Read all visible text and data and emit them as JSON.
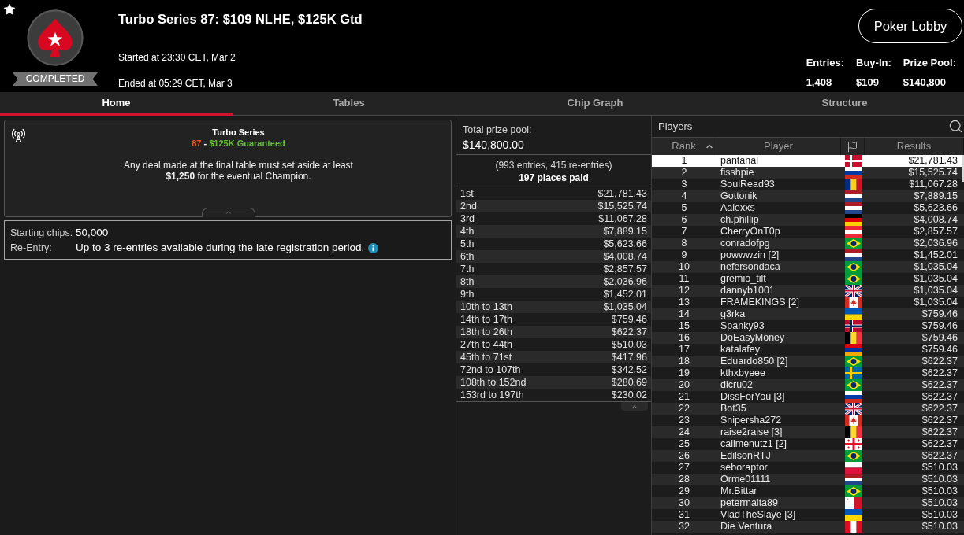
{
  "header": {
    "status_badge": "COMPLETED",
    "title": "Turbo Series 87: $109 NLHE, $125K Gtd",
    "started": "Started at 23:30 CET, Mar 2",
    "ended": "Ended at 05:29 CET, Mar 3",
    "lobby_button": "Poker Lobby",
    "stats": [
      {
        "label": "Entries:",
        "value": "1,408"
      },
      {
        "label": "Buy-In:",
        "value": "$109"
      },
      {
        "label": "Prize Pool:",
        "value": "$140,800"
      }
    ]
  },
  "tabs": [
    {
      "label": "Home",
      "selected": true
    },
    {
      "label": "Tables",
      "selected": false
    },
    {
      "label": "Chip Graph",
      "selected": false
    },
    {
      "label": "Structure",
      "selected": false
    }
  ],
  "info_card": {
    "series": "Turbo Series",
    "number": "87",
    "separator": "-",
    "guarantee": "$125K Guaranteed",
    "notice": "Any deal made at the final table must set aside at least **$1,250** for the eventual Champion."
  },
  "details": [
    {
      "label": "Starting chips:",
      "value": "50,000",
      "info": false
    },
    {
      "label": "Re-Entry:",
      "value": "Up to 3 re-entries available during the late registration period.",
      "info": true
    }
  ],
  "prize_pool": {
    "label": "Total prize pool:",
    "value": "$140,800.00",
    "entries": "(993 entries, 415 re-entries)",
    "places_paid": "197 places paid",
    "payouts": [
      {
        "place": "1st",
        "amount": "$21,781.43"
      },
      {
        "place": "2nd",
        "amount": "$15,525.74"
      },
      {
        "place": "3rd",
        "amount": "$11,067.28"
      },
      {
        "place": "4th",
        "amount": "$7,889.15"
      },
      {
        "place": "5th",
        "amount": "$5,623.66"
      },
      {
        "place": "6th",
        "amount": "$4,008.74"
      },
      {
        "place": "7th",
        "amount": "$2,857.57"
      },
      {
        "place": "8th",
        "amount": "$2,036.96"
      },
      {
        "place": "9th",
        "amount": "$1,452.01"
      },
      {
        "place": "10th to 13th",
        "amount": "$1,035.04"
      },
      {
        "place": "14th to 17th",
        "amount": "$759.46"
      },
      {
        "place": "18th to 26th",
        "amount": "$622.37"
      },
      {
        "place": "27th to 44th",
        "amount": "$510.03"
      },
      {
        "place": "45th to 71st",
        "amount": "$417.96"
      },
      {
        "place": "72nd to 107th",
        "amount": "$342.52"
      },
      {
        "place": "108th to 152nd",
        "amount": "$280.69"
      },
      {
        "place": "153rd to 197th",
        "amount": "$230.02"
      }
    ]
  },
  "players": {
    "title": "Players",
    "columns": [
      {
        "kind": "text",
        "label": "Rank",
        "sorted": true
      },
      {
        "kind": "text",
        "label": "Player",
        "sorted": false
      },
      {
        "kind": "flag",
        "sorted": false
      },
      {
        "kind": "text",
        "label": "Results",
        "sorted": false
      }
    ],
    "rows": [
      {
        "rank": "1",
        "name": "pantanal",
        "flag": {
          "kind": "denmark"
        },
        "result": "$21,781.43",
        "selected": true
      },
      {
        "rank": "2",
        "name": "fisshpie",
        "flag": {
          "kind": "russia"
        },
        "result": "$15,525.74",
        "selected": false
      },
      {
        "rank": "3",
        "name": "SoulRead93",
        "flag": {
          "kind": "romania"
        },
        "result": "$11,067.28",
        "selected": false
      },
      {
        "rank": "4",
        "name": "Gottonik",
        "flag": {
          "kind": "netherlands"
        },
        "result": "$7,889.15",
        "selected": false
      },
      {
        "rank": "5",
        "name": "Aalexxs",
        "flag": {
          "kind": "netherlands"
        },
        "result": "$5,623.66",
        "selected": false
      },
      {
        "rank": "6",
        "name": "ch.phillip",
        "flag": {
          "kind": "germany"
        },
        "result": "$4,008.74",
        "selected": false
      },
      {
        "rank": "7",
        "name": "CherryOnT0p",
        "flag": {
          "kind": "austria"
        },
        "result": "$2,857.57",
        "selected": false
      },
      {
        "rank": "8",
        "name": "conradofpg",
        "flag": {
          "kind": "brazil"
        },
        "result": "$2,036.96",
        "selected": false
      },
      {
        "rank": "9",
        "name": "powwwzin [2]",
        "flag": {
          "kind": "netherlands"
        },
        "result": "$1,452.01",
        "selected": false
      },
      {
        "rank": "10",
        "name": "nefersondaca",
        "flag": {
          "kind": "brazil"
        },
        "result": "$1,035.04",
        "selected": false
      },
      {
        "rank": "11",
        "name": "gremio_tilt",
        "flag": {
          "kind": "brazil"
        },
        "result": "$1,035.04",
        "selected": false
      },
      {
        "rank": "12",
        "name": "dannyb1001",
        "flag": {
          "kind": "uk"
        },
        "result": "$1,035.04",
        "selected": false
      },
      {
        "rank": "13",
        "name": "FRAMEKINGS [2]",
        "flag": {
          "kind": "canada"
        },
        "result": "$1,035.04",
        "selected": false
      },
      {
        "rank": "14",
        "name": "g3rka",
        "flag": {
          "kind": "ukraine"
        },
        "result": "$759.46",
        "selected": false
      },
      {
        "rank": "15",
        "name": "Spanky93",
        "flag": {
          "kind": "norway"
        },
        "result": "$759.46",
        "selected": false
      },
      {
        "rank": "16",
        "name": "DoEasyMoney",
        "flag": {
          "kind": "belgium"
        },
        "result": "$759.46",
        "selected": false
      },
      {
        "rank": "17",
        "name": "katalafey",
        "flag": {
          "kind": "armenia"
        },
        "result": "$759.46",
        "selected": false
      },
      {
        "rank": "18",
        "name": "Eduardo850 [2]",
        "flag": {
          "kind": "brazil"
        },
        "result": "$622.37",
        "selected": false
      },
      {
        "rank": "19",
        "name": "kthxbyeee",
        "flag": {
          "kind": "sweden"
        },
        "result": "$622.37",
        "selected": false
      },
      {
        "rank": "20",
        "name": "dicru02",
        "flag": {
          "kind": "brazil"
        },
        "result": "$622.37",
        "selected": false
      },
      {
        "rank": "21",
        "name": "DissForYou [3]",
        "flag": {
          "kind": "russia"
        },
        "result": "$622.37",
        "selected": false
      },
      {
        "rank": "22",
        "name": "Bot35",
        "flag": {
          "kind": "uk"
        },
        "result": "$622.37",
        "selected": false
      },
      {
        "rank": "23",
        "name": "Snipersha272",
        "flag": {
          "kind": "canada"
        },
        "result": "$622.37",
        "selected": false
      },
      {
        "rank": "24",
        "name": "raise2raise [3]",
        "flag": {
          "kind": "belgium"
        },
        "result": "$622.37",
        "selected": false
      },
      {
        "rank": "25",
        "name": "callmenutz1 [2]",
        "flag": {
          "kind": "georgia"
        },
        "result": "$622.37",
        "selected": false
      },
      {
        "rank": "26",
        "name": "EdilsonRTJ",
        "flag": {
          "kind": "brazil"
        },
        "result": "$622.37",
        "selected": false
      },
      {
        "rank": "27",
        "name": "seboraptor",
        "flag": {
          "kind": "poland"
        },
        "result": "$510.03",
        "selected": false
      },
      {
        "rank": "28",
        "name": "Orme01111",
        "flag": {
          "kind": "netherlands"
        },
        "result": "$510.03",
        "selected": false
      },
      {
        "rank": "29",
        "name": "Mr.Bittar",
        "flag": {
          "kind": "brazil"
        },
        "result": "$510.03",
        "selected": false
      },
      {
        "rank": "30",
        "name": "petermalta89",
        "flag": {
          "kind": "malta"
        },
        "result": "$510.03",
        "selected": false
      },
      {
        "rank": "31",
        "name": "VladTheSlaye [3]",
        "flag": {
          "kind": "ukraine"
        },
        "result": "$510.03",
        "selected": false
      },
      {
        "rank": "32",
        "name": "Die Ventura",
        "flag": {
          "kind": "peru"
        },
        "result": "$510.03",
        "selected": false
      }
    ]
  }
}
